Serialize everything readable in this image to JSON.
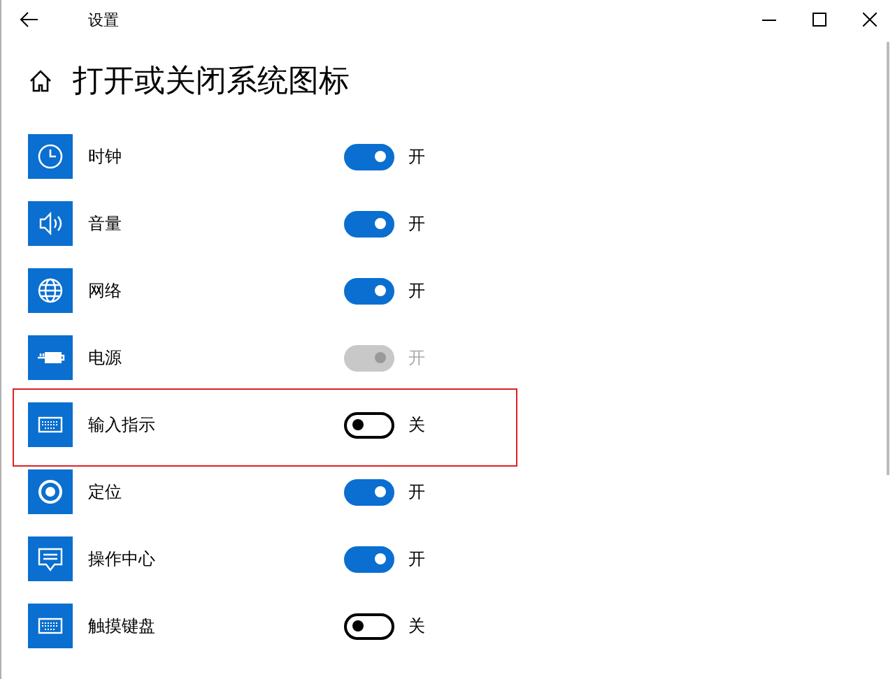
{
  "window": {
    "title": "设置"
  },
  "page": {
    "title": "打开或关闭系统图标"
  },
  "items": [
    {
      "kind": "clock",
      "label": "时钟",
      "on": true,
      "disabled": false,
      "state_text": "开",
      "highlighted": false
    },
    {
      "kind": "volume",
      "label": "音量",
      "on": true,
      "disabled": false,
      "state_text": "开",
      "highlighted": false
    },
    {
      "kind": "network",
      "label": "网络",
      "on": true,
      "disabled": false,
      "state_text": "开",
      "highlighted": false
    },
    {
      "kind": "power",
      "label": "电源",
      "on": true,
      "disabled": true,
      "state_text": "开",
      "highlighted": false
    },
    {
      "kind": "keyboard",
      "label": "输入指示",
      "on": false,
      "disabled": false,
      "state_text": "关",
      "highlighted": true
    },
    {
      "kind": "location",
      "label": "定位",
      "on": true,
      "disabled": false,
      "state_text": "开",
      "highlighted": false
    },
    {
      "kind": "action_center",
      "label": "操作中心",
      "on": true,
      "disabled": false,
      "state_text": "开",
      "highlighted": false
    },
    {
      "kind": "keyboard",
      "label": "触摸键盘",
      "on": false,
      "disabled": false,
      "state_text": "关",
      "highlighted": false
    }
  ]
}
